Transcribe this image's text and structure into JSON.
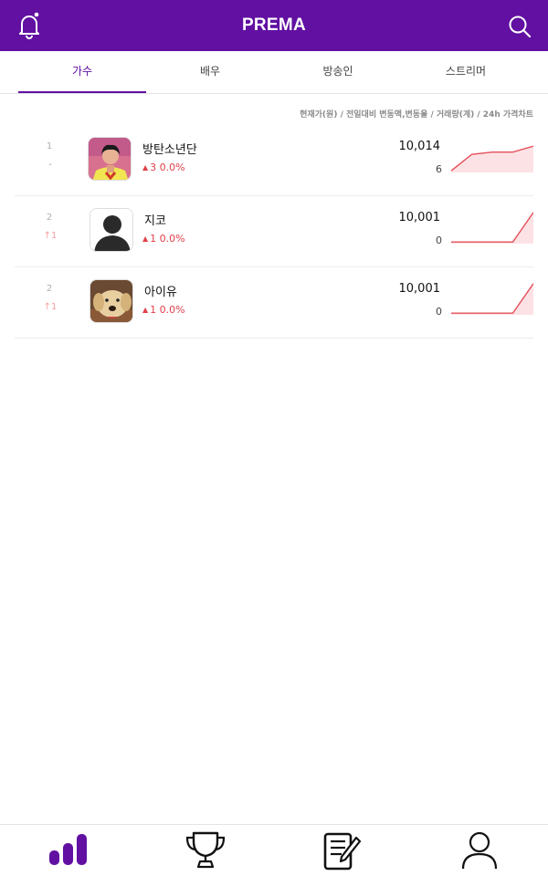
{
  "header": {
    "title": "PREMA",
    "bell_icon": "bell-icon",
    "search_icon": "search-icon"
  },
  "tabs": [
    {
      "label": "가수",
      "active": true
    },
    {
      "label": "배우",
      "active": false
    },
    {
      "label": "방송인",
      "active": false
    },
    {
      "label": "스트리머",
      "active": false
    }
  ],
  "legend": "현재가(원) / 전일대비 변동액,변동율 / 거래량(계) / 24h 가격차트",
  "rows": [
    {
      "rank": "1",
      "rank_change": "-",
      "name": "방탄소년단",
      "delta": "3 0.0%",
      "price": "10,014",
      "volume": "6",
      "trend": [
        0.05,
        0.55,
        0.62,
        0.62,
        0.8
      ]
    },
    {
      "rank": "2",
      "rank_change": "↑1",
      "name": "지코",
      "delta": "1 0.0%",
      "price": "10,001",
      "volume": "0",
      "trend": [
        0.05,
        0.05,
        0.05,
        0.05,
        0.95
      ]
    },
    {
      "rank": "2",
      "rank_change": "↑1",
      "name": "아이유",
      "delta": "1 0.0%",
      "price": "10,001",
      "volume": "0",
      "trend": [
        0.05,
        0.05,
        0.05,
        0.05,
        0.95
      ]
    }
  ],
  "colors": {
    "brand": "#6110a2",
    "up": "#e0404a",
    "chart_line": "#e4505a",
    "chart_fill": "#fde2e5"
  },
  "bottom_nav": [
    {
      "icon": "bar-chart-icon",
      "active": true
    },
    {
      "icon": "trophy-icon",
      "active": false
    },
    {
      "icon": "notepad-icon",
      "active": false
    },
    {
      "icon": "user-icon",
      "active": false
    }
  ]
}
